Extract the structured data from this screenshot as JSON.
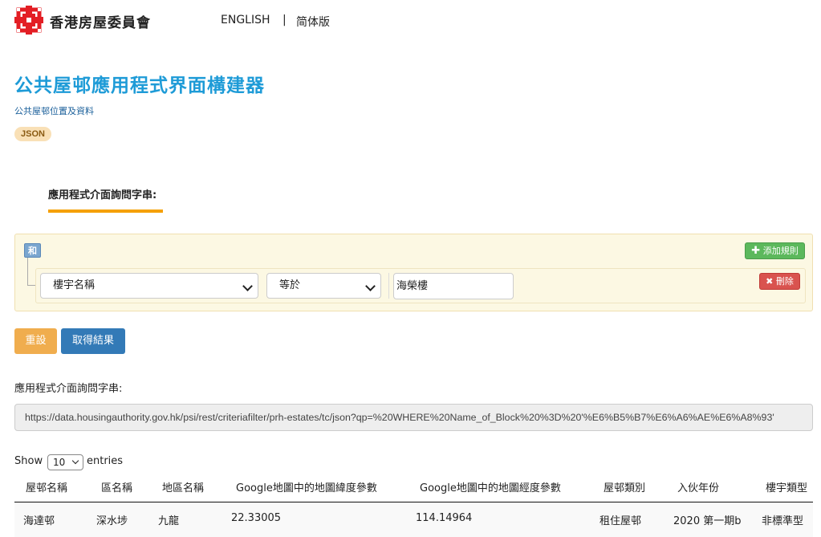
{
  "header": {
    "org_name": "香港房屋委員會",
    "lang_english": "ENGLISH",
    "lang_separator": "|",
    "lang_simplified": "简体版"
  },
  "page": {
    "title": "公共屋邨應用程式界面構建器",
    "subtitle": "公共屋邨位置及資料",
    "badge": "JSON",
    "tab_label": "應用程式介面詢問字串:"
  },
  "query_builder": {
    "group_condition": "和",
    "add_rule_label": "添加規則",
    "delete_label": "刪除",
    "rule": {
      "field": "樓宇名稱",
      "operator": "等於",
      "value": "海榮樓"
    }
  },
  "actions": {
    "reset_label": "重設",
    "get_results_label": "取得結果"
  },
  "api": {
    "label": "應用程式介面詢問字串:",
    "url": "https://data.housingauthority.gov.hk/psi/rest/criteriafilter/prh-estates/tc/json?qp=%20WHERE%20Name_of_Block%20%3D%20'%E6%B5%B7%E6%A6%AE%E6%A8%93'"
  },
  "table": {
    "show_label": "Show",
    "page_size": "10",
    "entries_label": "entries",
    "headers": [
      "屋邨名稱",
      "區名稱",
      "地區名稱",
      "Google地圖中的地圖緯度參數",
      "Google地圖中的地圖經度參數",
      "屋邨類別",
      "入伙年份",
      "樓宇類型"
    ],
    "rows": [
      [
        "海達邨",
        "深水埗",
        "九龍",
        "22.33005",
        "114.14964",
        "租住屋邨",
        "2020 第一期b",
        "非標準型"
      ]
    ]
  },
  "colors": {
    "title": "#1e9bd7",
    "accent_underline": "#f5a000",
    "reset_button": "#f0ad4e",
    "get_button": "#337ab7",
    "add_rule": "#5cb85c",
    "delete_rule": "#d9534f",
    "logo": "#e31e24"
  }
}
